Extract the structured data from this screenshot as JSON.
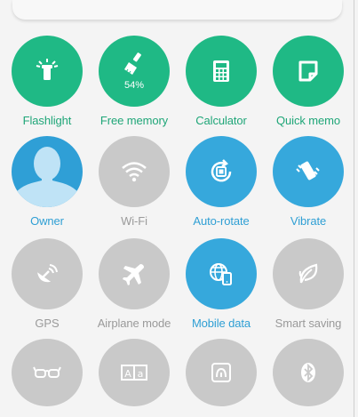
{
  "tiles": [
    {
      "label": "Flashlight",
      "icon": "flashlight-icon",
      "state": "green"
    },
    {
      "label": "Free memory",
      "icon": "broom-icon",
      "state": "green",
      "badge": "54%"
    },
    {
      "label": "Calculator",
      "icon": "calculator-icon",
      "state": "green"
    },
    {
      "label": "Quick memo",
      "icon": "memo-icon",
      "state": "green"
    },
    {
      "label": "Owner",
      "icon": "user-avatar-icon",
      "state": "blue"
    },
    {
      "label": "Wi-Fi",
      "icon": "wifi-icon",
      "state": "gray"
    },
    {
      "label": "Auto-rotate",
      "icon": "auto-rotate-icon",
      "state": "blue"
    },
    {
      "label": "Vibrate",
      "icon": "vibrate-icon",
      "state": "blue"
    },
    {
      "label": "GPS",
      "icon": "gps-icon",
      "state": "gray"
    },
    {
      "label": "Airplane mode",
      "icon": "airplane-icon",
      "state": "gray"
    },
    {
      "label": "Mobile data",
      "icon": "mobile-data-icon",
      "state": "blue"
    },
    {
      "label": "Smart saving",
      "icon": "leaf-icon",
      "state": "gray"
    },
    {
      "label": "",
      "icon": "reading-glasses-icon",
      "state": "gray"
    },
    {
      "label": "",
      "icon": "font-size-icon",
      "state": "gray"
    },
    {
      "label": "",
      "icon": "nfc-icon",
      "state": "gray"
    },
    {
      "label": "",
      "icon": "bluetooth-icon",
      "state": "gray"
    }
  ],
  "colors": {
    "green": "#1fb985",
    "blue": "#36a8dc",
    "gray": "#c9c9c9",
    "background": "#f4f4f4"
  }
}
